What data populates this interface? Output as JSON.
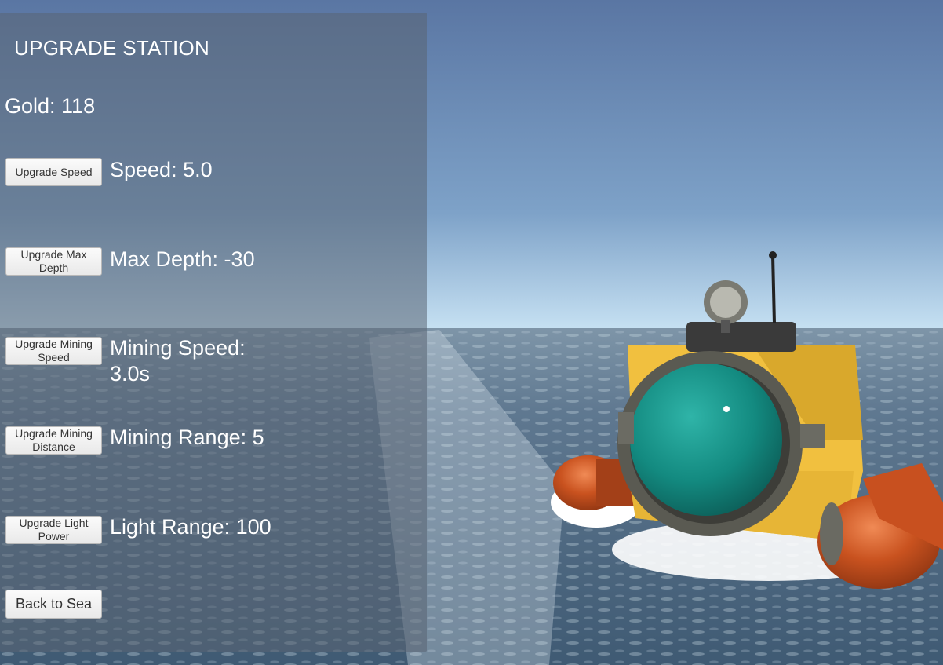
{
  "title": "UPGRADE STATION",
  "gold": "Gold: 118",
  "upgrades": [
    {
      "button": "Upgrade Speed",
      "stat": "Speed: 5.0"
    },
    {
      "button": "Upgrade Max Depth",
      "stat": "Max Depth: -30"
    },
    {
      "button": "Upgrade Mining Speed",
      "stat": "Mining Speed: 3.0s"
    },
    {
      "button": "Upgrade Mining Distance",
      "stat": "Mining Range: 5"
    },
    {
      "button": "Upgrade Light Power",
      "stat": "Light Range: 100"
    }
  ],
  "back_button": "Back to Sea",
  "colors": {
    "sky_top": "#5e7aa6",
    "sky_horizon": "#b9d6ec",
    "sea": "#566f86",
    "submarine_body": "#f0c040",
    "submarine_dome": "#17918a",
    "pontoon": "#c8501f"
  }
}
